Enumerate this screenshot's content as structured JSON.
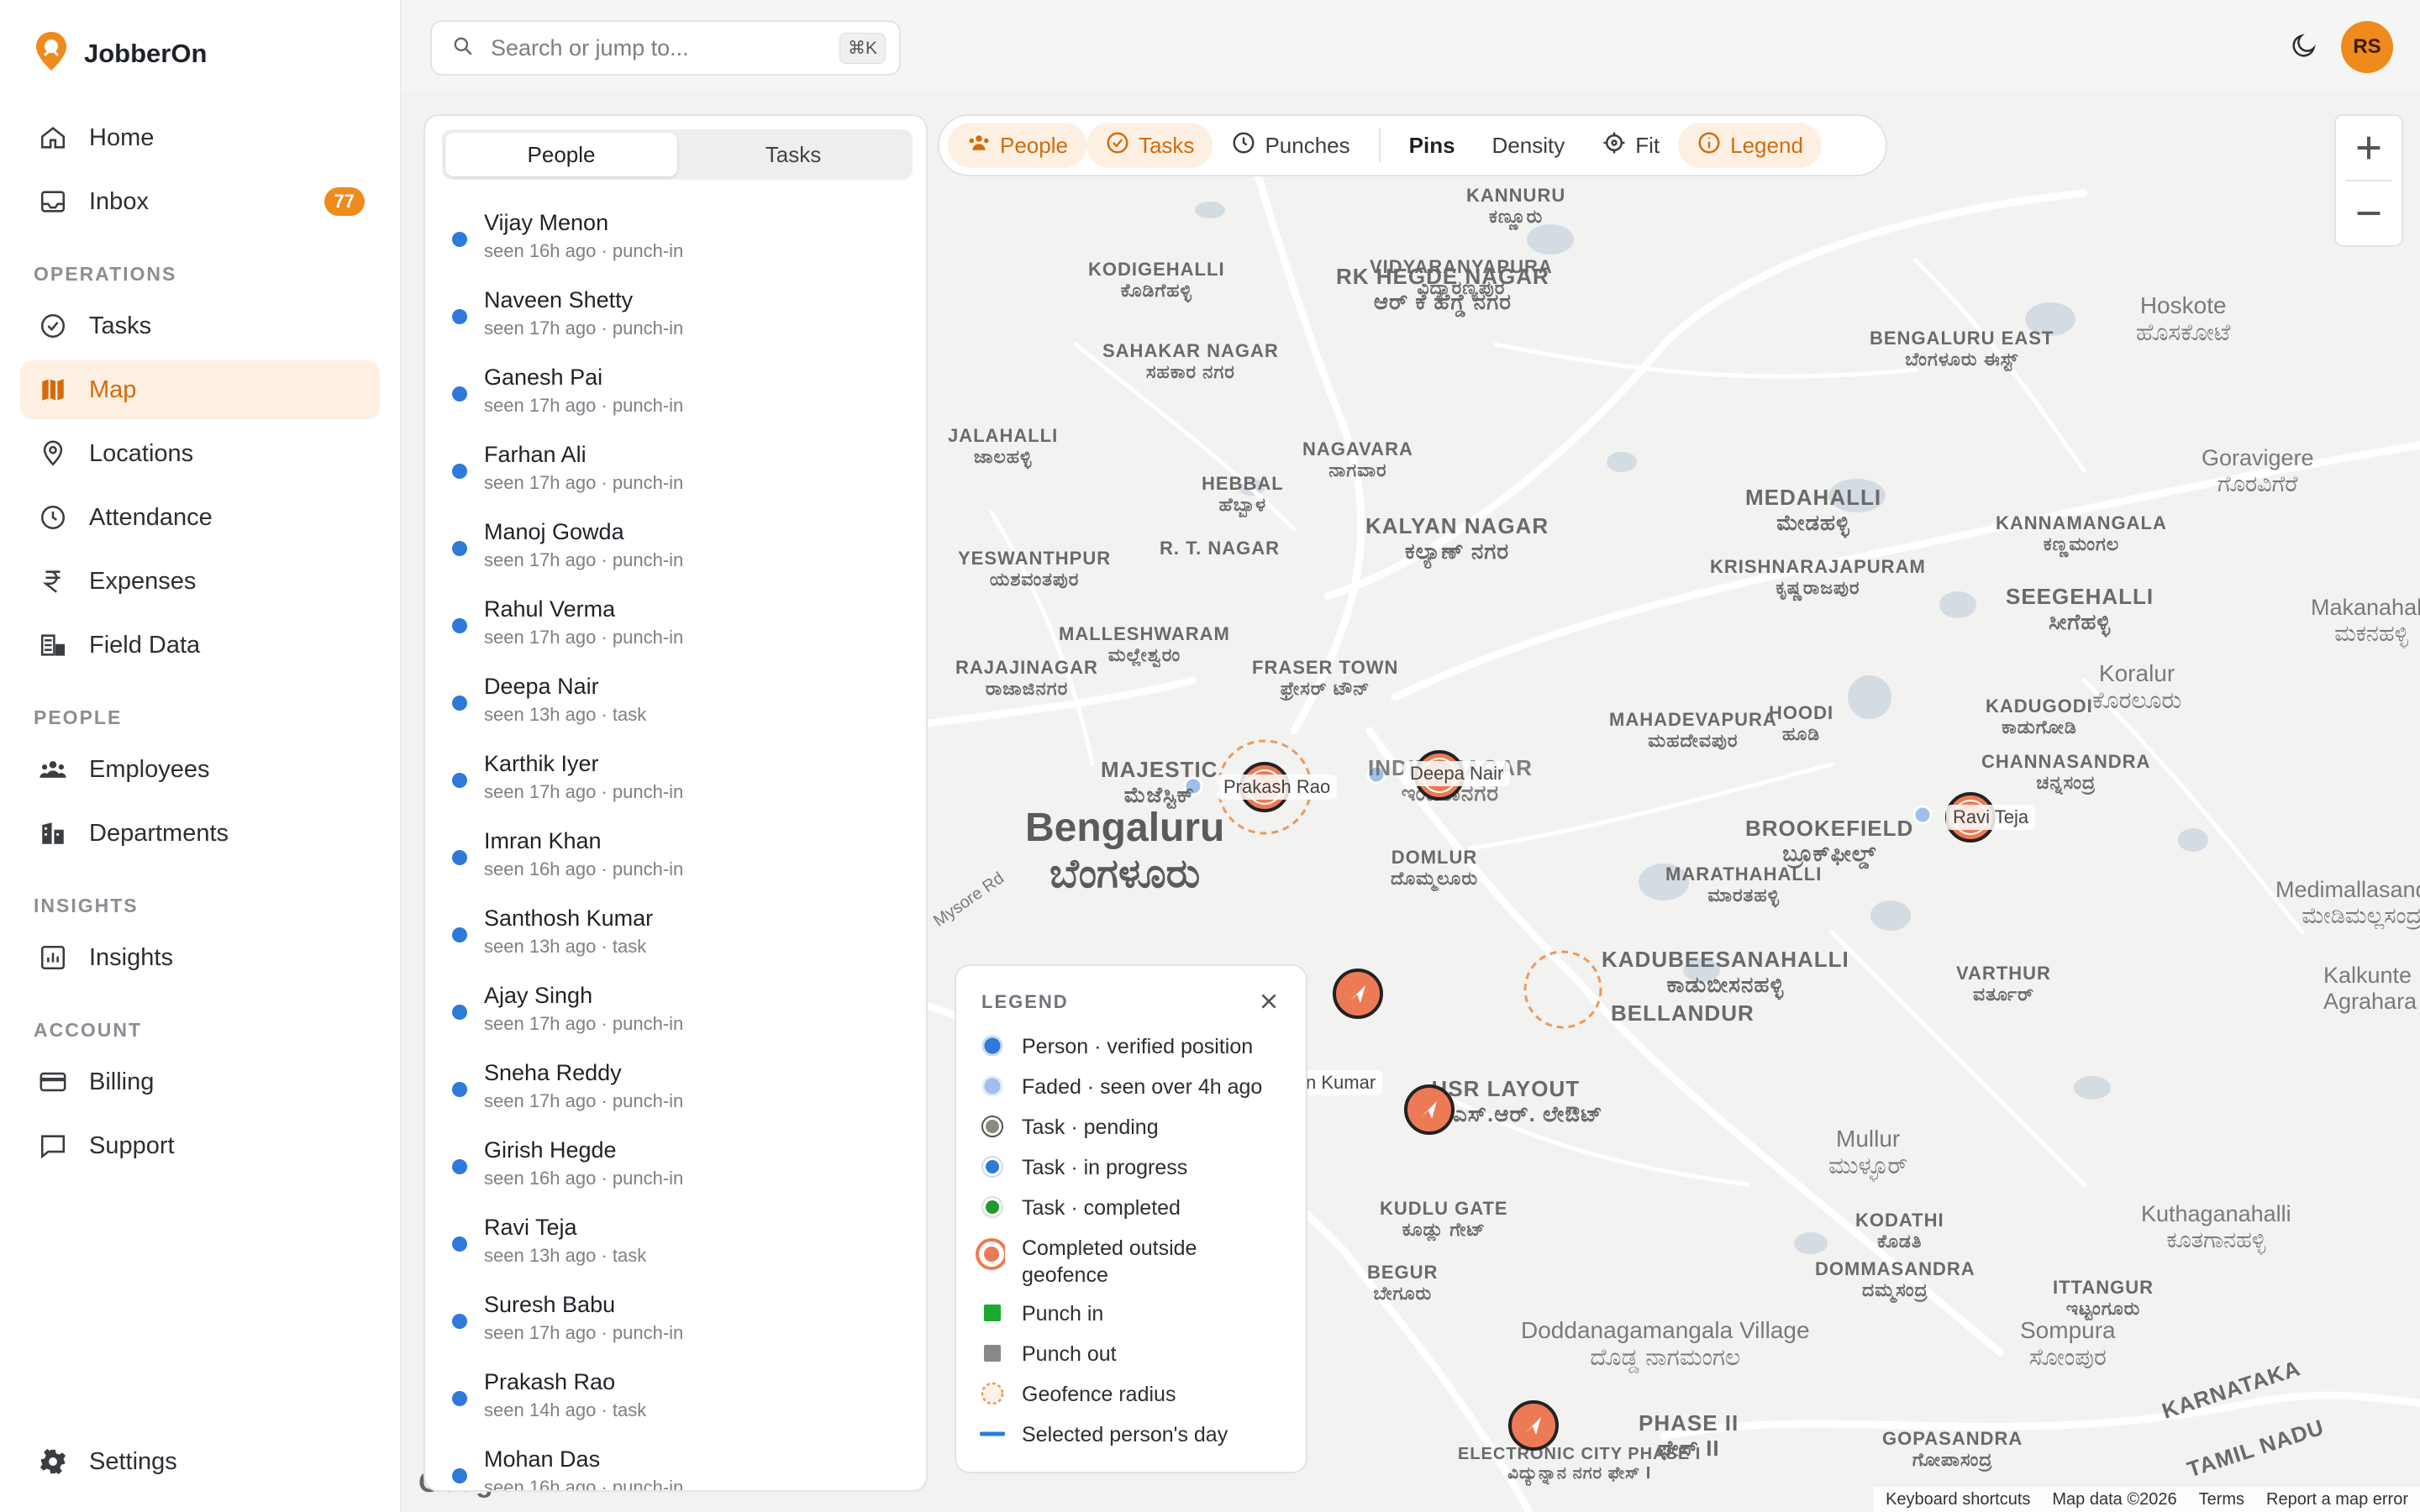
{
  "app": {
    "name": "JobberOn"
  },
  "sidebar": {
    "top_items": [
      {
        "label": "Home",
        "icon": "home-icon"
      },
      {
        "label": "Inbox",
        "icon": "inbox-icon",
        "badge": "77"
      }
    ],
    "sections": [
      {
        "label": "OPERATIONS",
        "items": [
          {
            "label": "Tasks",
            "icon": "check-circle-icon"
          },
          {
            "label": "Map",
            "icon": "map-icon",
            "active": true
          },
          {
            "label": "Locations",
            "icon": "location-pin-icon"
          },
          {
            "label": "Attendance",
            "icon": "clock-icon"
          },
          {
            "label": "Expenses",
            "icon": "rupee-icon"
          },
          {
            "label": "Field Data",
            "icon": "form-icon"
          }
        ]
      },
      {
        "label": "PEOPLE",
        "items": [
          {
            "label": "Employees",
            "icon": "users-icon"
          },
          {
            "label": "Departments",
            "icon": "building-icon"
          }
        ]
      },
      {
        "label": "INSIGHTS",
        "items": [
          {
            "label": "Insights",
            "icon": "chart-icon"
          }
        ]
      },
      {
        "label": "ACCOUNT",
        "items": [
          {
            "label": "Billing",
            "icon": "credit-card-icon"
          },
          {
            "label": "Support",
            "icon": "chat-icon"
          }
        ]
      }
    ],
    "settings_label": "Settings"
  },
  "topbar": {
    "search_placeholder": "Search or jump to...",
    "search_shortcut": "⌘K",
    "avatar_initials": "RS"
  },
  "list_panel": {
    "tabs": [
      "People",
      "Tasks"
    ],
    "active_tab": "People",
    "people": [
      {
        "name": "Vijay Menon",
        "status": "seen 16h ago · punch-in"
      },
      {
        "name": "Naveen Shetty",
        "status": "seen 17h ago · punch-in"
      },
      {
        "name": "Ganesh Pai",
        "status": "seen 17h ago · punch-in"
      },
      {
        "name": "Farhan Ali",
        "status": "seen 17h ago · punch-in"
      },
      {
        "name": "Manoj Gowda",
        "status": "seen 17h ago · punch-in"
      },
      {
        "name": "Rahul Verma",
        "status": "seen 17h ago · punch-in"
      },
      {
        "name": "Deepa Nair",
        "status": "seen 13h ago · task"
      },
      {
        "name": "Karthik Iyer",
        "status": "seen 17h ago · punch-in"
      },
      {
        "name": "Imran Khan",
        "status": "seen 16h ago · punch-in"
      },
      {
        "name": "Santhosh Kumar",
        "status": "seen 13h ago · task"
      },
      {
        "name": "Ajay Singh",
        "status": "seen 17h ago · punch-in"
      },
      {
        "name": "Sneha Reddy",
        "status": "seen 17h ago · punch-in"
      },
      {
        "name": "Girish Hegde",
        "status": "seen 16h ago · punch-in"
      },
      {
        "name": "Ravi Teja",
        "status": "seen 13h ago · task"
      },
      {
        "name": "Suresh Babu",
        "status": "seen 17h ago · punch-in"
      },
      {
        "name": "Prakash Rao",
        "status": "seen 14h ago · task"
      },
      {
        "name": "Mohan Das",
        "status": "seen 16h ago · punch-in"
      }
    ]
  },
  "map_toolbar": {
    "buttons": [
      {
        "label": "People",
        "icon": "users-icon",
        "on": true
      },
      {
        "label": "Tasks",
        "icon": "check-circle-icon",
        "on": true
      },
      {
        "label": "Punches",
        "icon": "clock-icon",
        "on": false
      },
      {
        "label": "Pins",
        "on": false,
        "selected": true
      },
      {
        "label": "Density",
        "on": false
      },
      {
        "label": "Fit",
        "icon": "crosshair-icon",
        "on": false
      },
      {
        "label": "Legend",
        "icon": "info-icon",
        "on": true
      }
    ]
  },
  "legend": {
    "title": "LEGEND",
    "items": [
      {
        "label": "Person · verified position",
        "symbol": "dot",
        "color": "#2f79d9"
      },
      {
        "label": "Faded · seen over 4h ago",
        "symbol": "dot",
        "color": "#9fc0ec"
      },
      {
        "label": "Task · pending",
        "symbol": "ring-dot",
        "color": "#8a8a80"
      },
      {
        "label": "Task · in progress",
        "symbol": "ring-dot",
        "color": "#2f79d9"
      },
      {
        "label": "Task · completed",
        "symbol": "ring-dot",
        "color": "#1f9a2e"
      },
      {
        "label": "Completed outside geofence",
        "symbol": "big-ring",
        "color": "#ec7a55"
      },
      {
        "label": "Punch in",
        "symbol": "square",
        "color": "#1aaa2e"
      },
      {
        "label": "Punch out",
        "symbol": "square",
        "color": "#888888"
      },
      {
        "label": "Geofence radius",
        "symbol": "dashed-circle",
        "color": "#e99a5e"
      },
      {
        "label": "Selected person's day",
        "symbol": "line",
        "color": "#2f79d9"
      }
    ]
  },
  "map": {
    "city_label": "Bengaluru",
    "city_label_local": "ಬೆಂಗಳೂರು",
    "labels": [
      {
        "t": "KANNURU",
        "l": "ಕಣ್ಣೂರು"
      },
      {
        "t": "VIDYARANYAPURA",
        "l": "ವಿದ್ಯಾರಣ್ಯಪುರ"
      },
      {
        "t": "RK HEGDE NAGAR",
        "l": "ಆರ್ ಕೆ ಹೆಗ್ಡೆ ನಗರ"
      },
      {
        "t": "Hoskote",
        "l": "ಹೊಸಕೋಟೆ"
      },
      {
        "t": "KODIGEHALLI",
        "l": "ಕೊಡಿಗೆಹಳ್ಳಿ"
      },
      {
        "t": "SAHAKAR NAGAR",
        "l": "ಸಹಕಾರ ನಗರ"
      },
      {
        "t": "BENGALURU EAST",
        "l": "ಬೆಂಗಳೂರು ಈಸ್ಟ್"
      },
      {
        "t": "JALAHALLI",
        "l": "ಜಾಲಹಳ್ಳಿ"
      },
      {
        "t": "NAGAVARA",
        "l": "ನಾಗವಾರ"
      },
      {
        "t": "Goravigere",
        "l": "ಗೊರವಿಗೆರೆ"
      },
      {
        "t": "HEBBAL",
        "l": "ಹೆಬ್ಬಾಳ"
      },
      {
        "t": "MEDAHALLI",
        "l": "ಮೇಡಹಳ್ಳಿ"
      },
      {
        "t": "KANNAMANGALA",
        "l": "ಕಣ್ಣಮಂಗಲ"
      },
      {
        "t": "KALYAN NAGAR",
        "l": "ಕಲ್ಯಾಣ್ ನಗರ"
      },
      {
        "t": "R. T. NAGAR",
        "l": "ಆರ್. ಟಿ. ನಗರ"
      },
      {
        "t": "YESWANTHPUR",
        "l": "ಯಶವಂತಪುರ"
      },
      {
        "t": "KRISHNARAJAPURAM",
        "l": "ಕೃಷ್ಣರಾಜಪುರ"
      },
      {
        "t": "SEEGEHALLI",
        "l": "ಸೀಗೆಹಳ್ಳಿ"
      },
      {
        "t": "Makanahalli",
        "l": "ಮಕನಹಳ್ಳಿ"
      },
      {
        "t": "MALLESHWARAM",
        "l": "ಮಲ್ಲೇಶ್ವರಂ"
      },
      {
        "t": "RAJAJINAGAR",
        "l": "ರಾಜಾಜಿನಗರ"
      },
      {
        "t": "FRASER TOWN",
        "l": "ಫ್ರೇಸರ್ ಟೌನ್"
      },
      {
        "t": "MAHADEVAPURA",
        "l": "ಮಹದೇವಪುರ"
      },
      {
        "t": "HOODI",
        "l": "ಹೂಡಿ"
      },
      {
        "t": "KADUGODI",
        "l": "ಕಾಡುಗೋಡಿ"
      },
      {
        "t": "Koralur",
        "l": "ಕೊರಲೂರು"
      },
      {
        "t": "MAJESTIC",
        "l": "ಮೆಜೆಸ್ಟಿಕ್"
      },
      {
        "t": "INDIRANAGAR",
        "l": "ಇಂದಿರಾನಗರ"
      },
      {
        "t": "CHANNASANDRA",
        "l": "ಚನ್ನಸಂದ್ರ"
      },
      {
        "t": "BROOKEFIELD",
        "l": "ಬ್ರೂಕ್‌ಫೀಲ್ಡ್"
      },
      {
        "t": "DOMLUR",
        "l": "ದೊಮ್ಮಲೂರು"
      },
      {
        "t": "MARATHAHALLI",
        "l": "ಮಾರತಹಳ್ಳಿ"
      },
      {
        "t": "Medimallasandra",
        "l": "ಮೇಡಿಮಲ್ಲಸಂದ್ರ"
      },
      {
        "t": "KADUBEESANAHALLI",
        "l": "ಕಾಡುಬೀಸನಹಳ್ಳಿ"
      },
      {
        "t": "BELLANDUR",
        "l": "ಬೆಳ್ಳಂದೂರು"
      },
      {
        "t": "VARTHUR",
        "l": "ವರ್ತೂರ್"
      },
      {
        "t": "Kalkunte Agrahara",
        "l": "ಕಲ್ಕುಂಟೆ ಅಗ್ರಹಾರ"
      },
      {
        "t": "HSR LAYOUT",
        "l": "ಎಚ್.ಎಸ್.ಆರ್. ಲೇಔಟ್"
      },
      {
        "t": "Mullur",
        "l": "ಮುಳ್ಳೂರ್"
      },
      {
        "t": "KODATHI",
        "l": "ಕೊಡತಿ"
      },
      {
        "t": "Kuthaganahalli",
        "l": "ಕೂತಗಾನಹಳ್ಳಿ"
      },
      {
        "t": "KUDLU GATE",
        "l": "ಕೂಡ್ಲು ಗೇಟ್"
      },
      {
        "t": "BEGUR",
        "l": "ಬೇಗೂರು"
      },
      {
        "t": "DOMMASANDRA",
        "l": "ದಮ್ಮಸಂದ್ರ"
      },
      {
        "t": "ITTANGUR",
        "l": "ಇಟ್ಟಂಗೂರು"
      },
      {
        "t": "Doddanagamangala Village",
        "l": "ದೊಡ್ಡ ನಾಗಮಂಗಲ"
      },
      {
        "t": "PHASE II",
        "l": "ಫೇಸ್ II"
      },
      {
        "t": "Sompura",
        "l": "ಸೋಂಪುರ"
      },
      {
        "t": "ELECTRONIC CITY PHASE I",
        "l": "ವಿದ್ಯುನ್ನಾನ ನಗರ ಫೇಸ್ I"
      },
      {
        "t": "GOPASANDRA",
        "l": "ಗೋಪಾಸಂದ್ರ"
      },
      {
        "t": "KARNATAKA",
        "l": ""
      },
      {
        "t": "TAMIL NADU",
        "l": ""
      },
      {
        "t": "Mysore Rd",
        "l": ""
      }
    ],
    "pins": [
      {
        "name": "Prakash Rao"
      },
      {
        "name": "Deepa Nair"
      },
      {
        "name": "Ravi Teja"
      },
      {
        "name": "n Kumar"
      }
    ],
    "footer": [
      "Keyboard shortcuts",
      "Map data ©2026",
      "Terms",
      "Report a map error"
    ],
    "attribution": "Google"
  }
}
